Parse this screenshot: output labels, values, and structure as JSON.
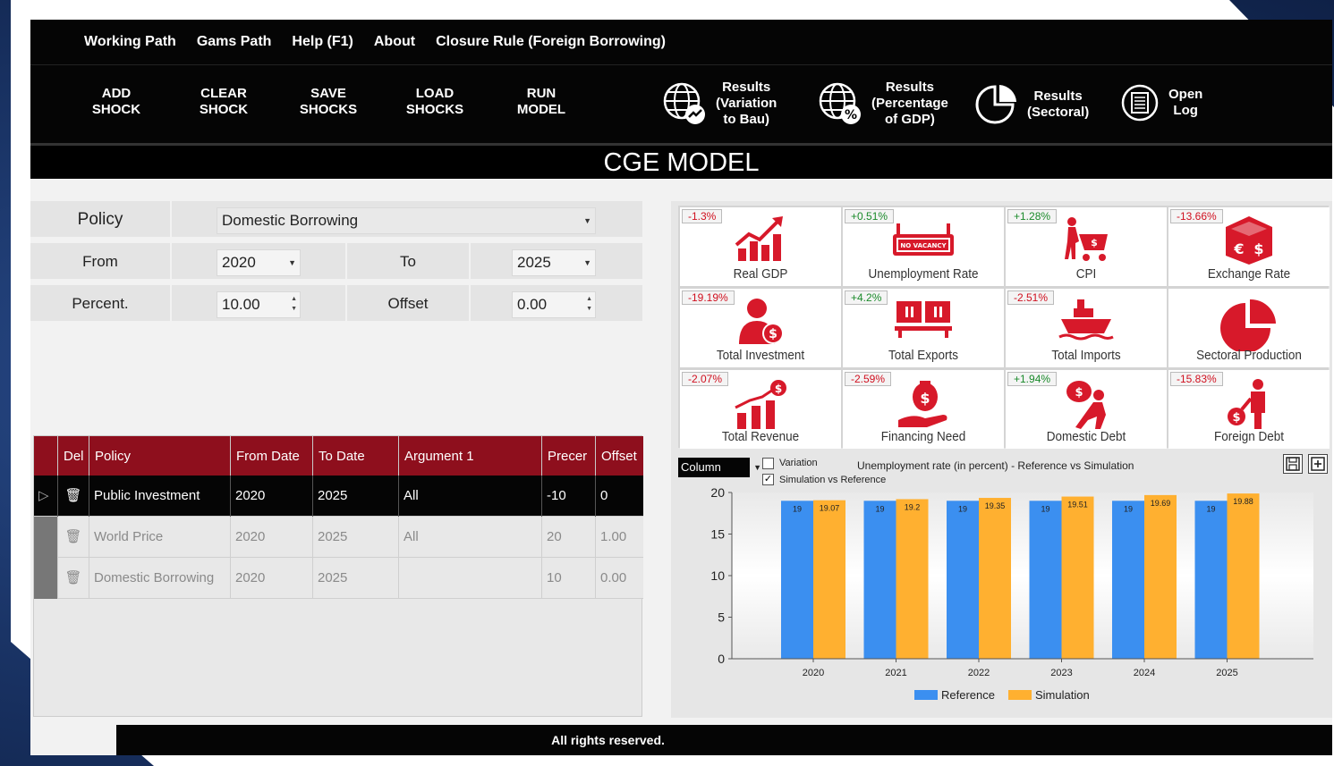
{
  "menu": [
    "Working Path",
    "Gams Path",
    "Help (F1)",
    "About",
    "Closure Rule (Foreign Borrowing)"
  ],
  "toolbar": {
    "add": "ADD\nSHOCK",
    "clear": "CLEAR\nSHOCK",
    "save": "SAVE\nSHOCKS",
    "load": "LOAD\nSHOCKS",
    "run": "RUN\nMODEL",
    "results_var": "Results\n(Variation\nto Bau)",
    "results_gdp": "Results\n(Percentage\nof GDP)",
    "results_sec": "Results\n(Sectoral)",
    "open_log": "Open\nLog"
  },
  "title": "CGE MODEL",
  "form": {
    "policy_label": "Policy",
    "policy_value": "Domestic Borrowing",
    "from_label": "From",
    "from_value": "2020",
    "to_label": "To",
    "to_value": "2025",
    "percent_label": "Percent.",
    "percent_value": "10.00",
    "offset_label": "Offset",
    "offset_value": "0.00"
  },
  "grid": {
    "headers": [
      "Del",
      "Policy",
      "From Date",
      "To Date",
      "Argument 1",
      "Precer",
      "Offset"
    ],
    "rows": [
      [
        "Public Investment",
        "2020",
        "2025",
        "All",
        "-10",
        "0"
      ],
      [
        "World Price",
        "2020",
        "2025",
        "All",
        "20",
        "1.00"
      ],
      [
        "Domestic Borrowing",
        "2020",
        "2025",
        "",
        "10",
        "0.00"
      ]
    ]
  },
  "tiles": [
    {
      "pct": "-1.3%",
      "label": "Real GDP",
      "icon": "gdp-chart-icon"
    },
    {
      "pct": "+0.51%",
      "label": "Unemployment Rate",
      "icon": "no-vacancy-icon"
    },
    {
      "pct": "+1.28%",
      "label": "CPI",
      "icon": "shopping-cart-icon"
    },
    {
      "pct": "-13.66%",
      "label": "Exchange Rate",
      "icon": "currency-exchange-icon"
    },
    {
      "pct": "-19.19%",
      "label": "Total Investment",
      "icon": "investor-icon"
    },
    {
      "pct": "+4.2%",
      "label": "Total Exports",
      "icon": "containers-icon"
    },
    {
      "pct": "-2.51%",
      "label": "Total Imports",
      "icon": "cargo-ship-icon"
    },
    {
      "pct": "",
      "label": "Sectoral Production",
      "icon": "pie-chart-icon"
    },
    {
      "pct": "-2.07%",
      "label": "Total Revenue",
      "icon": "revenue-bars-icon"
    },
    {
      "pct": "-2.59%",
      "label": "Financing Need",
      "icon": "hand-money-icon"
    },
    {
      "pct": "+1.94%",
      "label": "Domestic Debt",
      "icon": "debt-burden-icon"
    },
    {
      "pct": "-15.83%",
      "label": "Foreign Debt",
      "icon": "foreign-debt-icon"
    }
  ],
  "chart_controls": {
    "type_select": "Column",
    "variation_label": "Variation",
    "variation_checked": false,
    "sim_ref_label": "Simulation vs Reference",
    "sim_ref_checked": true,
    "title": "Unemployment rate (in percent) - Reference vs Simulation"
  },
  "chart_data": {
    "type": "bar",
    "title": "Unemployment rate (in percent) - Reference vs Simulation",
    "categories": [
      "2020",
      "2021",
      "2022",
      "2023",
      "2024",
      "2025"
    ],
    "series": [
      {
        "name": "Reference",
        "values": [
          19,
          19,
          19,
          19,
          19,
          19
        ],
        "labels": [
          "19",
          "19",
          "19",
          "19",
          "19",
          "19"
        ],
        "color": "#3b8ff0"
      },
      {
        "name": "Simulation",
        "values": [
          19.07,
          19.2,
          19.35,
          19.51,
          19.69,
          19.88
        ],
        "labels": [
          "19.07",
          "19.2",
          "19.35",
          "19.51",
          "19.69",
          "19.88"
        ],
        "color": "#ffb030"
      }
    ],
    "ylim": [
      0,
      20
    ],
    "yticks": [
      "0",
      "5",
      "10",
      "15",
      "20"
    ],
    "legend_position": "bottom"
  },
  "footer": "All rights reserved."
}
